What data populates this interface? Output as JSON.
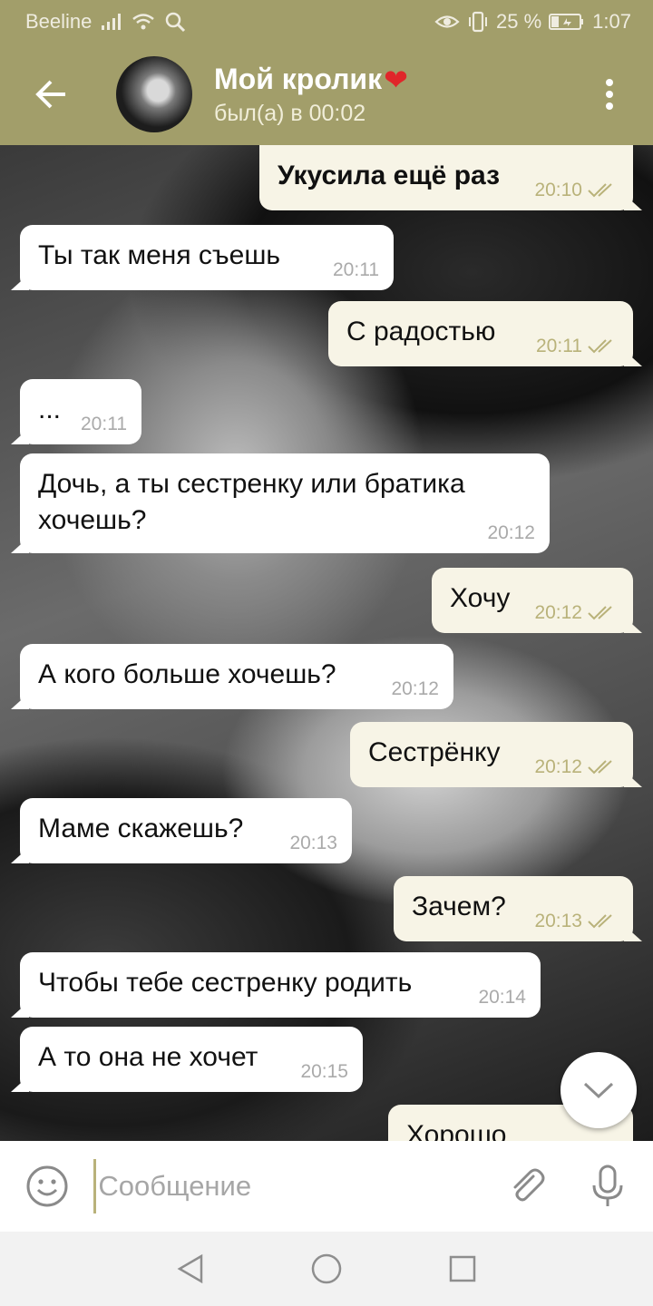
{
  "status_bar": {
    "carrier": "Beeline",
    "battery": "25 %",
    "time": "1:07"
  },
  "header": {
    "back_icon": "arrow-left-icon",
    "title": "Мой кролик",
    "title_emoji": "❤",
    "status": "был(а) в 00:02",
    "menu_icon": "more-vertical-icon"
  },
  "messages": [
    {
      "dir": "out",
      "text": "Укусила ещё раз",
      "time": "20:10",
      "read": true
    },
    {
      "dir": "in",
      "text": "Ты так меня съешь",
      "time": "20:11"
    },
    {
      "dir": "out",
      "text": "С радостью",
      "time": "20:11",
      "read": true
    },
    {
      "dir": "in",
      "text": "...",
      "time": "20:11"
    },
    {
      "dir": "in",
      "text": "Дочь, а ты сестренку или братика хочешь?",
      "time": "20:12"
    },
    {
      "dir": "out",
      "text": "Хочу",
      "time": "20:12",
      "read": true
    },
    {
      "dir": "in",
      "text": "А кого больше хочешь?",
      "time": "20:12"
    },
    {
      "dir": "out",
      "text": "Сестрёнку",
      "time": "20:12",
      "read": true
    },
    {
      "dir": "in",
      "text": "Маме скажешь?",
      "time": "20:13"
    },
    {
      "dir": "out",
      "text": "Зачем?",
      "time": "20:13",
      "read": true
    },
    {
      "dir": "in",
      "text": "Чтобы тебе сестренку родить",
      "time": "20:14"
    },
    {
      "dir": "in",
      "text": "А то она не хочет",
      "time": "20:15"
    },
    {
      "dir": "out",
      "text": "Хорошо",
      "time": "",
      "read": false
    }
  ],
  "composer": {
    "placeholder": "Сообщение",
    "emoji_icon": "emoji-icon",
    "attach_icon": "paperclip-icon",
    "mic_icon": "microphone-icon"
  },
  "colors": {
    "header": "#a29e6a",
    "outgoing_bubble": "#f7f4e6",
    "incoming_bubble": "#ffffff",
    "read_check": "#b9b27a"
  }
}
